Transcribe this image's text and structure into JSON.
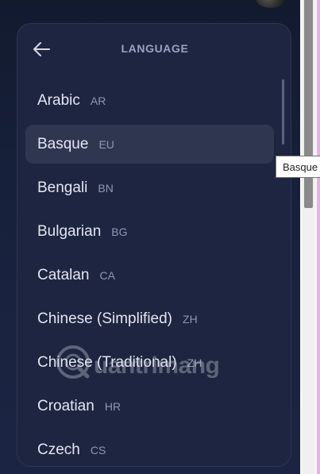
{
  "header": {
    "title": "LANGUAGE",
    "back_icon": "arrow-left-icon"
  },
  "languages": [
    {
      "name": "Arabic",
      "code": "AR"
    },
    {
      "name": "Basque",
      "code": "EU"
    },
    {
      "name": "Bengali",
      "code": "BN"
    },
    {
      "name": "Bulgarian",
      "code": "BG"
    },
    {
      "name": "Catalan",
      "code": "CA"
    },
    {
      "name": "Chinese (Simplified)",
      "code": "ZH"
    },
    {
      "name": "Chinese (Traditional)",
      "code": "ZH"
    },
    {
      "name": "Croatian",
      "code": "HR"
    },
    {
      "name": "Czech",
      "code": "CS"
    }
  ],
  "hovered_index": 1,
  "tooltip": {
    "text": "Basque"
  },
  "watermark": {
    "text": "uantrimang"
  },
  "colors": {
    "background": "#16203a",
    "panel": "#1d2540",
    "hover": "#2e3650",
    "title": "#9aa3c4",
    "language_name": "#e4e6f1",
    "language_code": "#8e97b6"
  }
}
